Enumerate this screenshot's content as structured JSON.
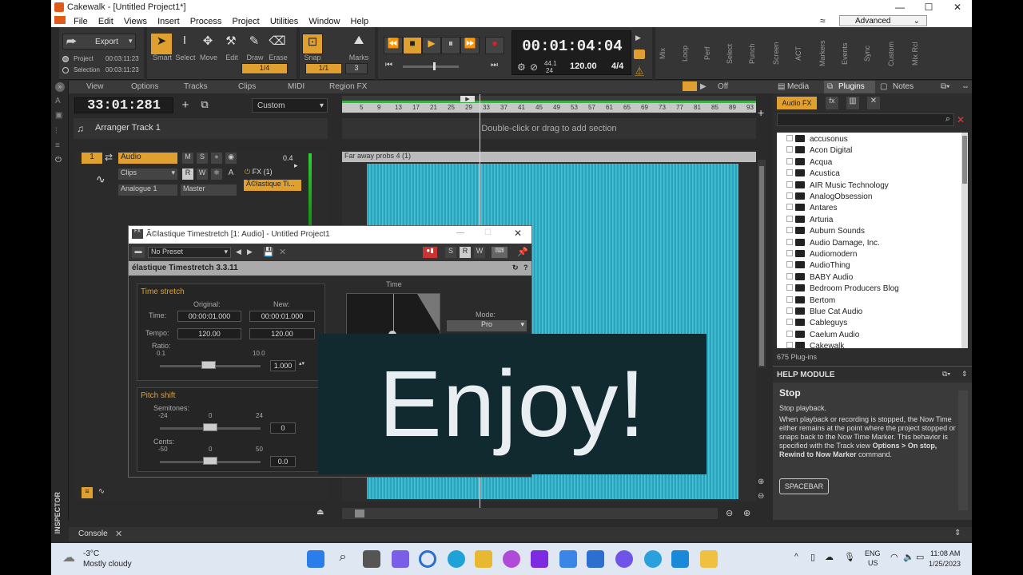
{
  "window": {
    "title": "Cakewalk - [Untitled Project1*]",
    "min": "—",
    "max": "☐",
    "close": "✕"
  },
  "menu": [
    "File",
    "Edit",
    "Views",
    "Insert",
    "Process",
    "Project",
    "Utilities",
    "Window",
    "Help"
  ],
  "workspace": "Advanced",
  "controlbar": {
    "export_label": "Export",
    "project_label": "Project",
    "project_time": "00:03:11:23",
    "selection_label": "Selection",
    "selection_time": "00:03:11:23",
    "tools": [
      "Smart",
      "Select",
      "Move",
      "Edit",
      "Draw",
      "Erase"
    ],
    "draw_fraction": "1/4",
    "snap_label": "Snap",
    "snap_value": "1/1",
    "marks_label": "Marks",
    "marks_value": "3",
    "now_time": "00:01:04:04",
    "sample_rate": "44.1",
    "bit_depth": "24",
    "tempo": "120.00",
    "meter": "4/4",
    "module_labels": [
      "Mix",
      "Loop",
      "Perf",
      "Select",
      "Punch",
      "Screen",
      "ACT",
      "Markers",
      "Events",
      "Sync",
      "Custom",
      "Mix Rcl"
    ]
  },
  "trackview": {
    "menu": [
      "View",
      "Options",
      "Tracks",
      "Clips",
      "MIDI",
      "Region FX"
    ],
    "off_label": "Off",
    "time_display": "33:01:281",
    "custom_label": "Custom",
    "ruler": [
      "5",
      "9",
      "13",
      "17",
      "21",
      "25",
      "29",
      "33",
      "37",
      "41",
      "45",
      "49",
      "53",
      "57",
      "61",
      "65",
      "69",
      "73",
      "77",
      "81",
      "85",
      "89",
      "93"
    ],
    "arranger_track": "Arranger Track 1",
    "arranger_hint": "Double-click or drag to add section",
    "track_number": "1",
    "track_name": "Audio",
    "track_volume": "0.4",
    "clips_label": "Clips",
    "input": "Analogue 1",
    "output": "Master",
    "fx_label": "FX (1)",
    "fx_item": "Ã©lastique Ti...",
    "clip_name": "Far away probs 4 (1)"
  },
  "plugin_dialog": {
    "title": "Ã©lastique Timestretch [1: Audio] - Untitled Project1",
    "preset": "No Preset",
    "letters": [
      "S",
      "R",
      "W"
    ],
    "header": "élastique Timestretch 3.3.11",
    "time_stretch": "Time stretch",
    "original_label": "Original:",
    "new_label": "New:",
    "time_label": "Time:",
    "orig_time": "00:00:01.000",
    "new_time": "00:00:01.000",
    "tempo_label": "Tempo:",
    "orig_tempo": "120.00",
    "new_tempo": "120.00",
    "ratio_label": "Ratio:",
    "ratio_min": "0.1",
    "ratio_max": "10.0",
    "ratio_value": "1.000",
    "graph_label": "Time",
    "mode_label": "Mode:",
    "mode_value": "Pro",
    "pitch_shift": "Pitch shift",
    "semitones_label": "Semitones:",
    "semi_min": "-24",
    "semi_mid": "0",
    "semi_max": "24",
    "semi_value": "0",
    "cents_label": "Cents:",
    "cents_min": "-50",
    "cents_mid": "0",
    "cents_max": "50",
    "cents_value": "0.0"
  },
  "overlay_text": "Enjoy!",
  "browser": {
    "tabs": [
      "Media",
      "Plugins",
      "Notes"
    ],
    "category": "Audio FX",
    "items": [
      "accusonus",
      "Acon Digital",
      "Acqua",
      "Acustica",
      "AIR Music Technology",
      "AnalogObsession",
      "Antares",
      "Arturia",
      "Auburn Sounds",
      "Audio Damage, Inc.",
      "Audiomodern",
      "AudioThing",
      "BABY Audio",
      "Bedroom Producers Blog",
      "Bertom",
      "Blue Cat Audio",
      "Cableguys",
      "Caelum Audio",
      "Cakewalk"
    ],
    "count": "675 Plug-ins"
  },
  "help": {
    "title": "HELP MODULE",
    "heading": "Stop",
    "line1": "Stop playback.",
    "body": "When playback or recording is stopped, the Now Time either remains at the point where the project stopped or snaps back to the Now Time Marker. This behavior is specified with the Track view",
    "bold": "Options > On stop, Rewind to Now Marker",
    "tail": "command.",
    "key": "SPACEBAR"
  },
  "inspector_label": "INSPECTOR",
  "console_label": "Console",
  "taskbar": {
    "temp": "-3°C",
    "weather": "Mostly cloudy",
    "lang1": "ENG",
    "lang2": "US",
    "time": "11:08 AM",
    "date": "1/25/2023"
  }
}
